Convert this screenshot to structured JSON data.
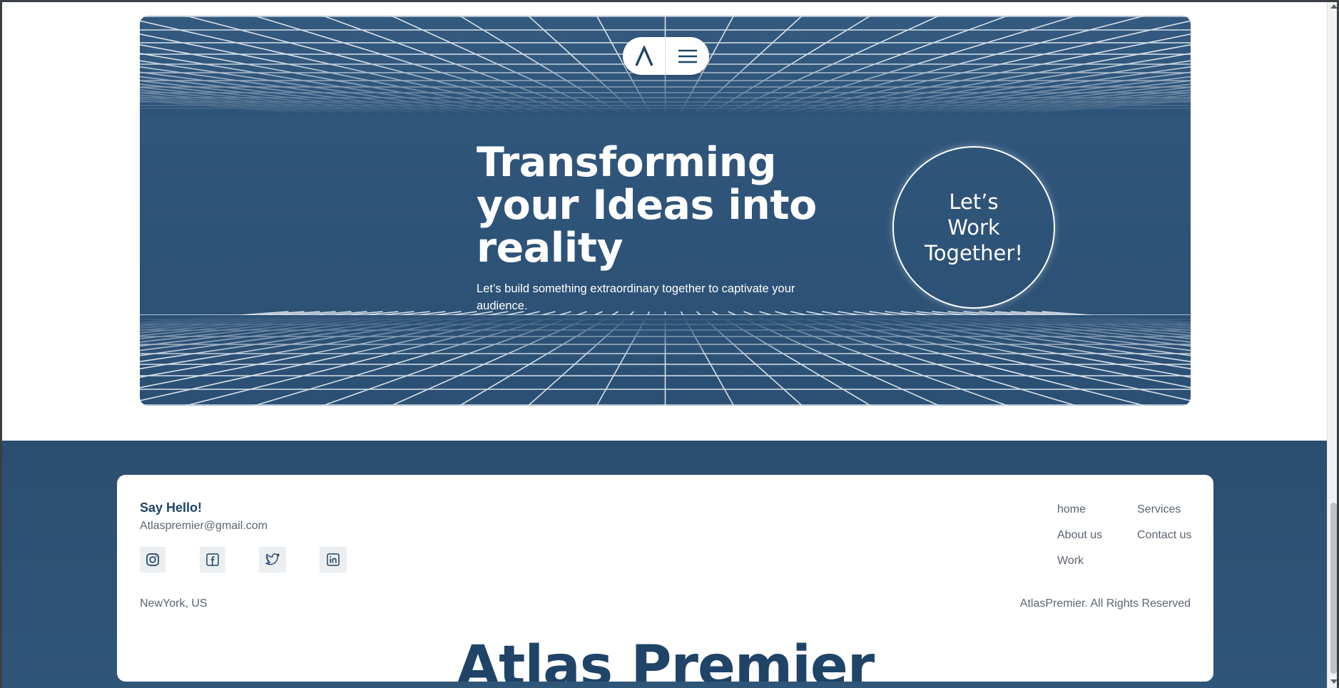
{
  "nav": {
    "logo_glyph": "Λ",
    "logo_icon": "atlas-logo-icon",
    "menu_icon": "hamburger-menu-icon"
  },
  "hero": {
    "title": "Transforming your Ideas into reality",
    "subtitle": "Let’s build something extraordinary together to captivate your audience.",
    "cta": "Let’s Work Together!"
  },
  "footer": {
    "say_hello": "Say Hello!",
    "email": "Atlaspremier@gmail.com",
    "socials": [
      {
        "icon": "instagram-icon"
      },
      {
        "icon": "facebook-icon"
      },
      {
        "icon": "twitter-icon"
      },
      {
        "icon": "linkedin-icon"
      }
    ],
    "links": [
      {
        "label": "home"
      },
      {
        "label": "Services"
      },
      {
        "label": "About us"
      },
      {
        "label": "Contact us"
      },
      {
        "label": "Work"
      }
    ],
    "location": "NewYork, US",
    "rights": "AtlasPremier. All Rights Reserved",
    "brand": "Atlas Premier"
  },
  "colors": {
    "primary": "#2f5479",
    "text_dark": "#1f4468",
    "text_muted": "#5b6470",
    "white": "#ffffff"
  }
}
